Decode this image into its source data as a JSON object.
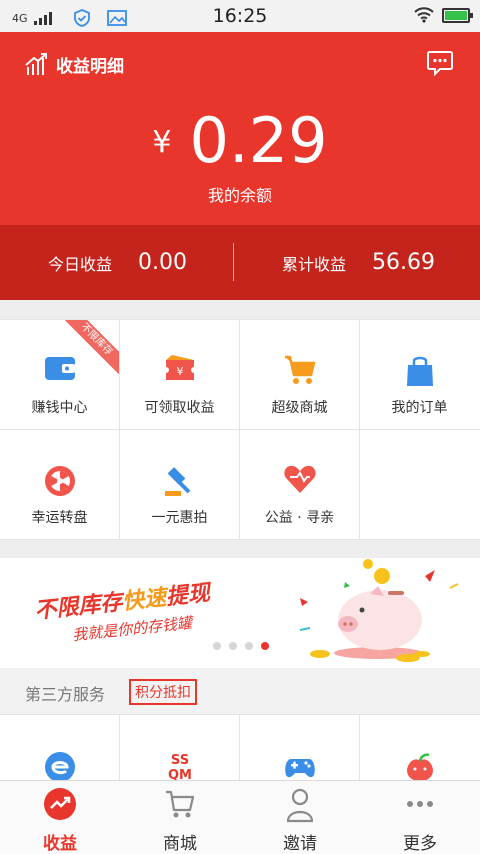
{
  "status_bar": {
    "network": "4G",
    "time": "16:25",
    "battery_level": 1.0
  },
  "header": {
    "title": "收益明细",
    "currency_symbol": "¥",
    "balance": "0.29",
    "balance_label": "我的余额",
    "today_label": "今日收益",
    "today_value": "0.00",
    "total_label": "累计收益",
    "total_value": "56.69",
    "bg_color": "#e8362c",
    "bar_color": "#c4241c"
  },
  "menu": {
    "items": [
      {
        "label": "赚钱中心",
        "icon": "wallet-icon",
        "ribbon": "不限库存"
      },
      {
        "label": "可领取收益",
        "icon": "ticket-yen-icon"
      },
      {
        "label": "超级商城",
        "icon": "shopping-cart-icon"
      },
      {
        "label": "我的订单",
        "icon": "shopping-bag-icon"
      },
      {
        "label": "幸运转盘",
        "icon": "lucky-wheel-icon"
      },
      {
        "label": "一元惠拍",
        "icon": "auction-hammer-icon"
      },
      {
        "label": "公益 · 寻亲",
        "icon": "heart-icon"
      }
    ]
  },
  "banner": {
    "line1_a": "不限库存",
    "line1_b": "快速",
    "line1_c": "提现",
    "line2": "我就是你的存钱罐",
    "page_count": 4,
    "active_page": 4
  },
  "third_party": {
    "title": "第三方服务",
    "badge": "积分抵扣",
    "icons": [
      "e-browser-icon",
      "ssqm-icon",
      "gamepad-icon",
      "peach-icon"
    ]
  },
  "tabs": [
    {
      "label": "收益",
      "icon": "earnings-trend-icon",
      "active": true
    },
    {
      "label": "商城",
      "icon": "cart-icon",
      "active": false
    },
    {
      "label": "邀请",
      "icon": "person-icon",
      "active": false
    },
    {
      "label": "更多",
      "icon": "more-dots-icon",
      "active": false
    }
  ]
}
